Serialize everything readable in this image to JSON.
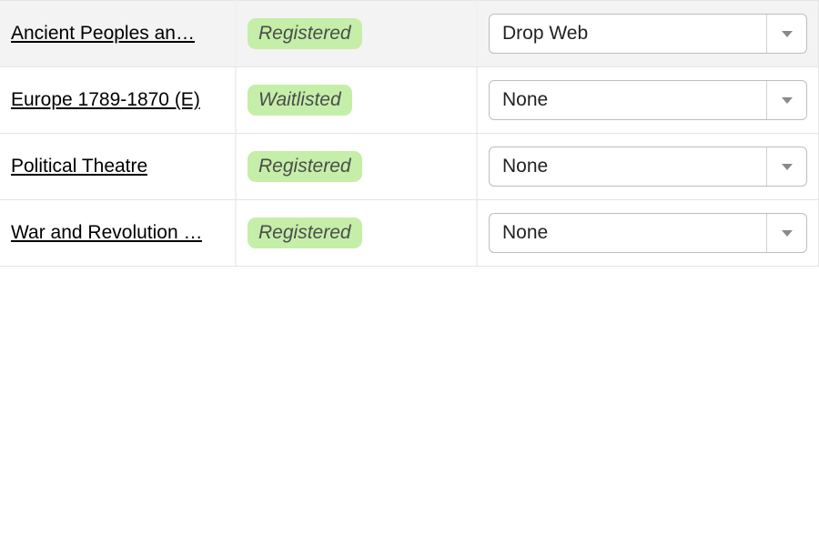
{
  "status_colors": {
    "registered_bg": "#c5eea9",
    "waitlisted_bg": "#c5eea9"
  },
  "rows": [
    {
      "title": "Ancient Peoples an…",
      "status": "Registered",
      "action": "Drop Web",
      "highlighted": true
    },
    {
      "title": "Europe 1789-1870 (E)",
      "status": "Waitlisted",
      "action": "None",
      "highlighted": false
    },
    {
      "title": "Political Theatre",
      "status": "Registered",
      "action": "None",
      "highlighted": false
    },
    {
      "title": "War and Revolution …",
      "status": "Registered",
      "action": "None",
      "highlighted": false
    }
  ]
}
